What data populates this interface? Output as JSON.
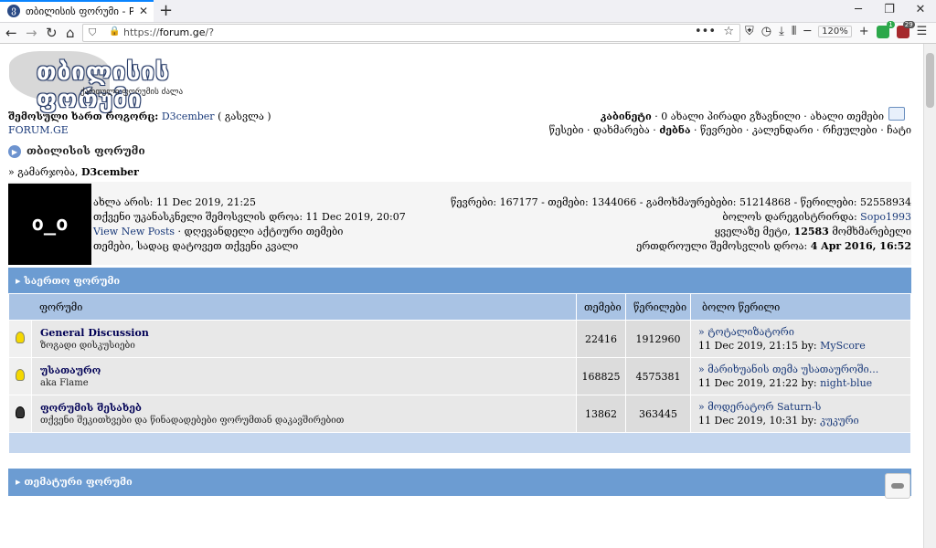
{
  "browser": {
    "tab_title": "თბილისის ფორუმი - Powe",
    "tab_favicon": "ვ",
    "url_prefix": "https://",
    "url_host": "forum.ge",
    "url_path": "/?",
    "zoom": "120%",
    "ext_badge_1": "1",
    "ext_badge_2": "29"
  },
  "header": {
    "logo_title": "თბილისის ფორუმი",
    "logo_sub": "ქართული ფორუმის ძალა",
    "logged_in_text": "შემოსული ხართ როგორც:",
    "username": "D3cember",
    "logout": "( გასვლა )",
    "site_link": "FORUM.GE",
    "cabinet": "კაბინეტი",
    "new_pm": "0 ახალი პირადი გზავნილი",
    "new_topics": "ახალი თემები",
    "nav_links": [
      "წესები",
      "დახმარება",
      "ძებნა",
      "წევრები",
      "კალენდარი",
      "რჩეულები",
      "ჩატი"
    ]
  },
  "breadcrumb": "თბილისის ფორუმი",
  "welcome": {
    "prefix": "» გამარჯობა,",
    "name": "D3cember"
  },
  "info": {
    "avatar_text": "o_o",
    "now": "ახლა არის: 11 Dec 2019, 21:25",
    "last_visit": "თქვენი უკანასკნელი შემოსვლის დროა: 11 Dec 2019, 20:07",
    "view_new": "View New Posts",
    "active_topics": "დღევანდელი აქტიური თემები",
    "tracked": "თემები, სადაც დატოვეთ თქვენი კვალი",
    "stats": "წევრები: 167177 - თემები: 1344066 - გამოხმაურებები: 51214868 - წერილები: 52558934",
    "last_reg_label": "ბოლოს დარეგისტრირდა:",
    "last_reg_name": "Sopo1993",
    "most_online_pre": "ყველაზე მეტი,",
    "most_online_num": "12583",
    "most_online_post": "მომხმარებელი",
    "simul_label": "ერთდროული შემოსვლის დროა:",
    "simul_date": "4 Apr 2016, 16:52"
  },
  "section1": {
    "title": "საერთო ფორუმი"
  },
  "table": {
    "headers": {
      "forum": "ფორუმი",
      "topics": "თემები",
      "posts": "წერილები",
      "last": "ბოლო წერილი"
    },
    "rows": [
      {
        "title": "General Discussion",
        "desc": "ზოგადი დისკუსიები",
        "topics": "22416",
        "posts": "1912960",
        "last_topic": "» ტოტალიზატორი",
        "last_date": "11 Dec 2019, 21:15 by:",
        "last_by": "MyScore",
        "icon": "lightbulb-icon"
      },
      {
        "title": "უსათაურო",
        "desc": "aka Flame",
        "topics": "168825",
        "posts": "4575381",
        "last_topic": "» მარიხუანის თემა უსათაუროში...",
        "last_date": "11 Dec 2019, 21:22 by:",
        "last_by": "night-blue",
        "icon": "lightbulb-icon"
      },
      {
        "title": "ფორუმის შესახებ",
        "desc": "თქვენი შეკითხვები და წინადადებები ფორუმთან დაკავშირებით",
        "topics": "13862",
        "posts": "363445",
        "last_topic": "» მოდერატორ Saturn-ს",
        "last_date": "11 Dec 2019, 10:31 by:",
        "last_by": "კუკური",
        "icon": "lightbulb-off-icon"
      }
    ]
  },
  "section2": {
    "title": "თემატური ფორუმი"
  },
  "colors": {
    "category_bar": "#6c9cd2",
    "header_row": "#a9c3e4",
    "tab_accent": "#0a84ff"
  }
}
